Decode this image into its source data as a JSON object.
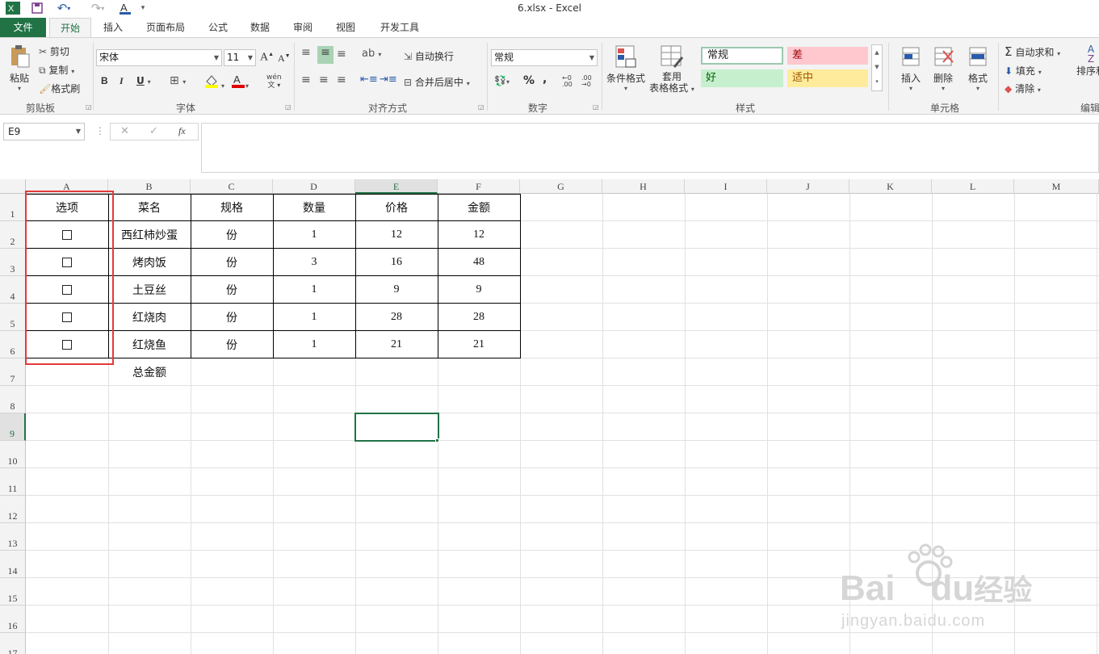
{
  "window": {
    "title": "6.xlsx - Excel"
  },
  "quick_access": {
    "save_icon": "save-icon",
    "undo_icon": "undo-icon",
    "redo_icon": "redo-icon",
    "font_color_icon": "font-color-icon"
  },
  "tabs": [
    {
      "label": "文件"
    },
    {
      "label": "开始"
    },
    {
      "label": "插入"
    },
    {
      "label": "页面布局"
    },
    {
      "label": "公式"
    },
    {
      "label": "数据"
    },
    {
      "label": "审阅"
    },
    {
      "label": "视图"
    },
    {
      "label": "开发工具"
    }
  ],
  "ribbon": {
    "clipboard": {
      "paste": "粘贴",
      "cut": "剪切",
      "copy": "复制",
      "format_painter": "格式刷",
      "label": "剪贴板"
    },
    "font": {
      "font_name": "宋体",
      "font_size": "11",
      "bold": "B",
      "italic": "I",
      "underline": "U",
      "label": "字体",
      "wen": "wén"
    },
    "alignment": {
      "wrap": "自动换行",
      "merge": "合并后居中",
      "label": "对齐方式"
    },
    "number": {
      "format": "常规",
      "percent": "%",
      "comma": ",",
      "label": "数字"
    },
    "styles": {
      "conditional": "条件格式",
      "table_fmt_1": "套用",
      "table_fmt_2": "表格格式",
      "normal": "常规",
      "bad": "差",
      "good": "好",
      "neutral": "适中",
      "label": "样式",
      "colors": {
        "normal_border": "#9bc8b0",
        "bad_bg": "#ffc7ce",
        "bad_fg": "#9c0006",
        "good_bg": "#c6efce",
        "good_fg": "#006100",
        "neutral_bg": "#ffeb9c",
        "neutral_fg": "#9c5700"
      }
    },
    "cells": {
      "insert": "插入",
      "delete": "删除",
      "format": "格式",
      "label": "单元格"
    },
    "editing": {
      "autosum": "自动求和",
      "fill": "填充",
      "clear": "清除",
      "sort": "排序和",
      "label": "编辑"
    }
  },
  "formula_bar": {
    "name_box": "E9",
    "fx": "fx",
    "value": ""
  },
  "sheet": {
    "columns": [
      "A",
      "B",
      "C",
      "D",
      "E",
      "F",
      "G",
      "H",
      "I",
      "J",
      "K",
      "L",
      "M"
    ],
    "rows": [
      "1",
      "2",
      "3",
      "4",
      "5",
      "6",
      "7",
      "8",
      "9",
      "10",
      "11",
      "12",
      "13",
      "14",
      "15",
      "16",
      "17"
    ],
    "selected_cell": "E9",
    "headers": [
      "选项",
      "菜名",
      "规格",
      "数量",
      "价格",
      "金额"
    ],
    "data": [
      {
        "dish": "西红柿炒蛋",
        "unit": "份",
        "qty": "1",
        "price": "12",
        "amount": "12"
      },
      {
        "dish": "烤肉饭",
        "unit": "份",
        "qty": "3",
        "price": "16",
        "amount": "48"
      },
      {
        "dish": "土豆丝",
        "unit": "份",
        "qty": "1",
        "price": "9",
        "amount": "9"
      },
      {
        "dish": "红烧肉",
        "unit": "份",
        "qty": "1",
        "price": "28",
        "amount": "28"
      },
      {
        "dish": "红烧鱼",
        "unit": "份",
        "qty": "1",
        "price": "21",
        "amount": "21"
      }
    ],
    "total_label": "总金额"
  },
  "watermark": {
    "brand": "Bai",
    "brand2": "du",
    "brand_cn": "经验",
    "url": "jingyan.baidu.com"
  },
  "accent": "#217346",
  "highlight": "#e23a3a"
}
